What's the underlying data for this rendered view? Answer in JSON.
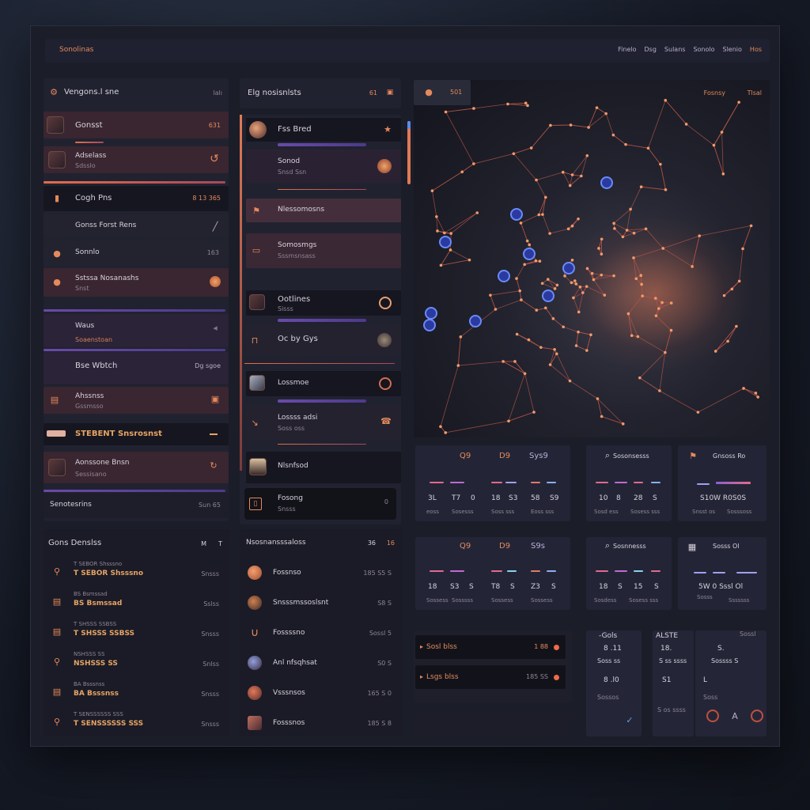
{
  "topbar": {
    "title": "Sonolinas",
    "menu": [
      "Finelo",
      "Dsg",
      "Sulans",
      "Sonolo",
      "Slenio",
      "Hos"
    ]
  },
  "col1": {
    "header": "Vengons.l sne",
    "header_badge": "lalı",
    "item1": {
      "label": "Gonsst",
      "value": "631"
    },
    "item2": {
      "label": "Adselass",
      "sub": "Sdsslo"
    },
    "item3": {
      "label": "Cogh Pns",
      "value": "8 13 365"
    },
    "item4": {
      "label": "Gonss Forst Rens"
    },
    "item5": {
      "label": "Sonnlo",
      "value": "163"
    },
    "item6": {
      "label": "Sstssa Nosanashs",
      "sub": "Snst"
    },
    "item7": {
      "label": "Waus",
      "sub": "Soaenstoan"
    },
    "item8": {
      "label": "Bse Wbtch",
      "value": "Dg  sgoe"
    },
    "item9": {
      "label": "Ahssnss",
      "sub": "Gssmsso"
    },
    "item10": {
      "label": "STEBENT Snsrosnst"
    },
    "item11": {
      "label": "Aonssone Bnsn",
      "sub": "Sessisano"
    },
    "footer": {
      "label": "Senotesrins",
      "value": "Sun 65"
    }
  },
  "col2": {
    "header": "Elg nosisnlsts",
    "header_value": "61",
    "items": [
      {
        "label": "Fss Bred",
        "sub": ""
      },
      {
        "label": "Sonod",
        "sub": "Snsd Ssn"
      },
      {
        "label": "Nlessomosns",
        "sub": ""
      },
      {
        "label": "Somosmgs",
        "sub": "Sssmsnsass"
      },
      {
        "label": "Ootlines",
        "sub": "Sisss"
      },
      {
        "label": "Oc by Gys",
        "sub": ""
      },
      {
        "label": "Lossmoe",
        "sub": ""
      },
      {
        "label": "Lossss adsi",
        "sub": "Soss oss"
      },
      {
        "label": "Nlsnfsod",
        "sub": ""
      },
      {
        "label": "Fosong",
        "sub": "Snsss"
      }
    ],
    "footer_value": "0"
  },
  "map": {
    "zoom": "501",
    "labels": [
      "Fosnsy",
      "Tlsal"
    ]
  },
  "stats_row1": {
    "card1": {
      "headers": [
        "Q9",
        "D9",
        "Sys9"
      ],
      "values": [
        "3L",
        "T7",
        "0",
        "18",
        "S3",
        "58",
        "S9"
      ],
      "subs": [
        "eoss",
        "Sosesss",
        "Soss sss",
        "Eoss sss"
      ]
    },
    "card2": {
      "headers": [
        "Sosonsesss"
      ],
      "values": [
        "10",
        "8",
        "28",
        "S"
      ],
      "subs": [
        "Sosd ess",
        "Sosess sss"
      ]
    },
    "card3": {
      "headers": [
        "Gnsoss Ro"
      ],
      "values": [
        "S10W R0S0S"
      ],
      "subs": [
        "Snsst os",
        "Sosssoss"
      ]
    }
  },
  "stats_row2": {
    "card1": {
      "headers": [
        "Q9",
        "D9",
        "S9s"
      ],
      "values": [
        "18",
        "S3",
        "S",
        "T8",
        "S",
        "Z3",
        "S"
      ],
      "subs": [
        "Sossess",
        "Sosssss",
        "Sossess",
        "Sossess"
      ]
    },
    "card2": {
      "headers": [
        "Sosnnesss"
      ],
      "values": [
        "18",
        "S",
        "15",
        "S"
      ],
      "subs": [
        "Sosdess",
        "Sosess sss"
      ]
    },
    "card3": {
      "headers": [
        "Sosss Ol"
      ],
      "values": [
        "5W 0 Sssl Ol"
      ],
      "subs": [
        "Sosss",
        "Sssssss"
      ]
    }
  },
  "bottom_left": {
    "header": "Gons Denslss",
    "header_values": [
      "M",
      "T"
    ],
    "rows": [
      {
        "a": "T SEBOR Shsssno",
        "b": "Snsss"
      },
      {
        "a": "BS Bsmssad",
        "b": "Sslss"
      },
      {
        "a": "T SHSSS SSBSS",
        "b": "Snsss"
      },
      {
        "a": "NSHSSS SS",
        "b": "Snlss"
      },
      {
        "a": "BA Bsssnss",
        "b": "Snsss"
      },
      {
        "a": "T SENSSSSSS SSS",
        "b": "Snsss"
      }
    ]
  },
  "bottom_mid": {
    "header": "Nsosnansssaloss",
    "header_values": [
      "36",
      "16"
    ],
    "rows": [
      {
        "label": "Fossnso",
        "value": "185 S5 S"
      },
      {
        "label": "Snsssmssoslsnt",
        "value": "S8 S"
      },
      {
        "label": "Fossssno",
        "value": "Sossl 5"
      },
      {
        "label": "Anl nfsqhsat",
        "value": "S0 S"
      },
      {
        "label": "Vsssnsos",
        "value": "165 S 0"
      },
      {
        "label": "Fosssnos",
        "value": "185 S 8"
      }
    ]
  },
  "alerts": [
    {
      "label": "Sosl blss",
      "value": "1 88"
    },
    {
      "label": "Lsgs blss",
      "value": "185 SS"
    }
  ],
  "mini_cards": [
    {
      "title": "-Gols",
      "v1": "8 .11",
      "s1": "Soss ss",
      "v2": "8 .l0",
      "s2": "Sossos"
    },
    {
      "title": "ALSTE",
      "v1": "18.",
      "s1": "S ss ssss",
      "v2": "S1",
      "s2": "S os ssss"
    },
    {
      "title": "Sossl",
      "v1": "S.",
      "s1": "Sossss  S",
      "v2": "L",
      "s2": "Soss"
    }
  ],
  "colors": {
    "accent": "#e58a5c",
    "violet": "#6a4aa8",
    "bg": "#1b1d29",
    "blue": "#4d7df0"
  }
}
